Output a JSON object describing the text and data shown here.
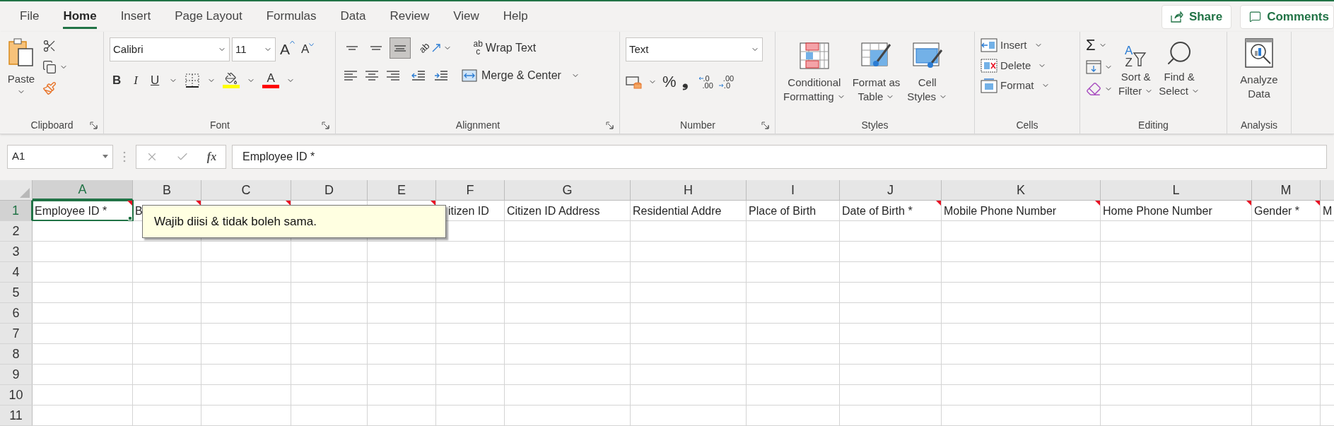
{
  "menu_tabs": [
    {
      "label": "File",
      "selected": false
    },
    {
      "label": "Home",
      "selected": true
    },
    {
      "label": "Insert",
      "selected": false
    },
    {
      "label": "Page Layout",
      "selected": false
    },
    {
      "label": "Formulas",
      "selected": false
    },
    {
      "label": "Data",
      "selected": false
    },
    {
      "label": "Review",
      "selected": false
    },
    {
      "label": "View",
      "selected": false
    },
    {
      "label": "Help",
      "selected": false
    }
  ],
  "share_button": "Share",
  "comments_button": "Comments",
  "clipboard": {
    "label": "Clipboard",
    "paste": "Paste"
  },
  "font": {
    "label": "Font",
    "font_name": "Calibri",
    "font_size": "11",
    "grow": "A",
    "shrink": "A",
    "bold": "B",
    "italic": "I",
    "underline": "U",
    "color_glyph": "A"
  },
  "alignment": {
    "label": "Alignment",
    "vertical": [
      {
        "selected": false
      },
      {
        "selected": false
      },
      {
        "selected": true
      }
    ],
    "orientation_glyph": "ab",
    "wrap_glyphs": [
      "ab",
      "c"
    ],
    "wrap_text": "Wrap Text",
    "merge_center": "Merge & Center"
  },
  "number": {
    "label": "Number",
    "format": "Text",
    "percent": "%",
    "comma": "❟",
    "increase_decimal": [
      ".0",
      ".00"
    ],
    "decrease_decimal": [
      ".00",
      ".0"
    ]
  },
  "styles": {
    "label": "Styles",
    "buttons": [
      {
        "kind": "conditional",
        "lines": [
          "Conditional",
          "Formatting"
        ]
      },
      {
        "kind": "table",
        "lines": [
          "Format as",
          "Table"
        ]
      },
      {
        "kind": "cell",
        "lines": [
          "Cell",
          "Styles"
        ]
      }
    ]
  },
  "cells": {
    "label": "Cells",
    "buttons": [
      {
        "kind": "insert",
        "text": "Insert"
      },
      {
        "kind": "delete",
        "text": "Delete"
      },
      {
        "kind": "format",
        "text": "Format"
      }
    ]
  },
  "editing": {
    "label": "Editing",
    "sum_glyph": "Σ",
    "sort_glyphs": [
      "A",
      "Z"
    ],
    "sort_filter": [
      "Sort &",
      "Filter"
    ],
    "find_select": [
      "Find &",
      "Select"
    ]
  },
  "analysis": {
    "label": "Analysis",
    "analyze": [
      "Analyze",
      "Data"
    ]
  },
  "formula_bar": {
    "name_box": "A1",
    "fx": "fx",
    "formula": "Employee ID *"
  },
  "columns": [
    {
      "letter": "A",
      "selected": true
    },
    {
      "letter": "B",
      "selected": false
    },
    {
      "letter": "C",
      "selected": false
    },
    {
      "letter": "D",
      "selected": false
    },
    {
      "letter": "E",
      "selected": false
    },
    {
      "letter": "F",
      "selected": false
    },
    {
      "letter": "G",
      "selected": false
    },
    {
      "letter": "H",
      "selected": false
    },
    {
      "letter": "I",
      "selected": false
    },
    {
      "letter": "J",
      "selected": false
    },
    {
      "letter": "K",
      "selected": false
    },
    {
      "letter": "L",
      "selected": false
    },
    {
      "letter": "M",
      "selected": false
    }
  ],
  "rows": [
    {
      "number": "1",
      "selected": true
    },
    {
      "number": "2",
      "selected": false
    },
    {
      "number": "3",
      "selected": false
    },
    {
      "number": "4",
      "selected": false
    },
    {
      "number": "5",
      "selected": false
    },
    {
      "number": "6",
      "selected": false
    },
    {
      "number": "7",
      "selected": false
    },
    {
      "number": "8",
      "selected": false
    },
    {
      "number": "9",
      "selected": false
    },
    {
      "number": "10",
      "selected": false
    },
    {
      "number": "11",
      "selected": false
    }
  ],
  "row_1_cells": [
    {
      "text": "Employee ID *",
      "comment": true,
      "selected": true
    },
    {
      "text": "B",
      "comment": true,
      "selected": false
    },
    {
      "comment": true,
      "selected": false
    },
    {
      "comment": false,
      "selected": false
    },
    {
      "comment": true,
      "selected": false
    },
    {
      "text": "itizen ID",
      "comment": false,
      "selected": false,
      "covered_start": true
    },
    {
      "text": "Citizen ID Address",
      "comment": false,
      "selected": false
    },
    {
      "text": "Residential Addre",
      "comment": false,
      "selected": false
    },
    {
      "text": "Place of Birth",
      "comment": false,
      "selected": false
    },
    {
      "text": "Date of Birth *",
      "comment": true,
      "selected": false
    },
    {
      "text": "Mobile Phone Number",
      "comment": true,
      "selected": false
    },
    {
      "text": "Home Phone Number",
      "comment": true,
      "selected": false
    },
    {
      "text": "Gender *",
      "comment": true,
      "selected": false
    },
    {
      "text": "M",
      "comment": false,
      "selected": false
    }
  ],
  "comment_tooltip": "Wajib diisi & tidak boleh sama."
}
